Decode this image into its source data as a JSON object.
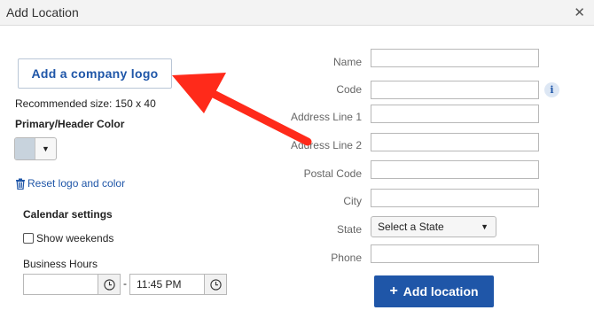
{
  "dialog": {
    "title": "Add Location",
    "close_glyph": "✕"
  },
  "logo": {
    "button_label": "Add a company logo",
    "recommended_size": "Recommended size: 150 x 40",
    "color_label": "Primary/Header Color",
    "swatch_color": "#c8d3dd",
    "reset_label": "Reset logo and color"
  },
  "calendar": {
    "title": "Calendar settings",
    "show_weekends_label": "Show weekends",
    "show_weekends_checked": false,
    "business_hours_label": "Business Hours",
    "start_time": "",
    "separator": "-",
    "end_time": "11:45 PM"
  },
  "form": {
    "name_label": "Name",
    "code_label": "Code",
    "address1_label": "Address Line 1",
    "address2_label": "Address Line 2",
    "postal_label": "Postal Code",
    "city_label": "City",
    "state_label": "State",
    "state_value": "Select a State",
    "phone_label": "Phone",
    "info_glyph": "i"
  },
  "submit": {
    "label": "Add location",
    "plus": "+"
  },
  "annotation": {
    "arrow_color": "#ff2a1a"
  },
  "colors": {
    "accent": "#1f56a8"
  }
}
